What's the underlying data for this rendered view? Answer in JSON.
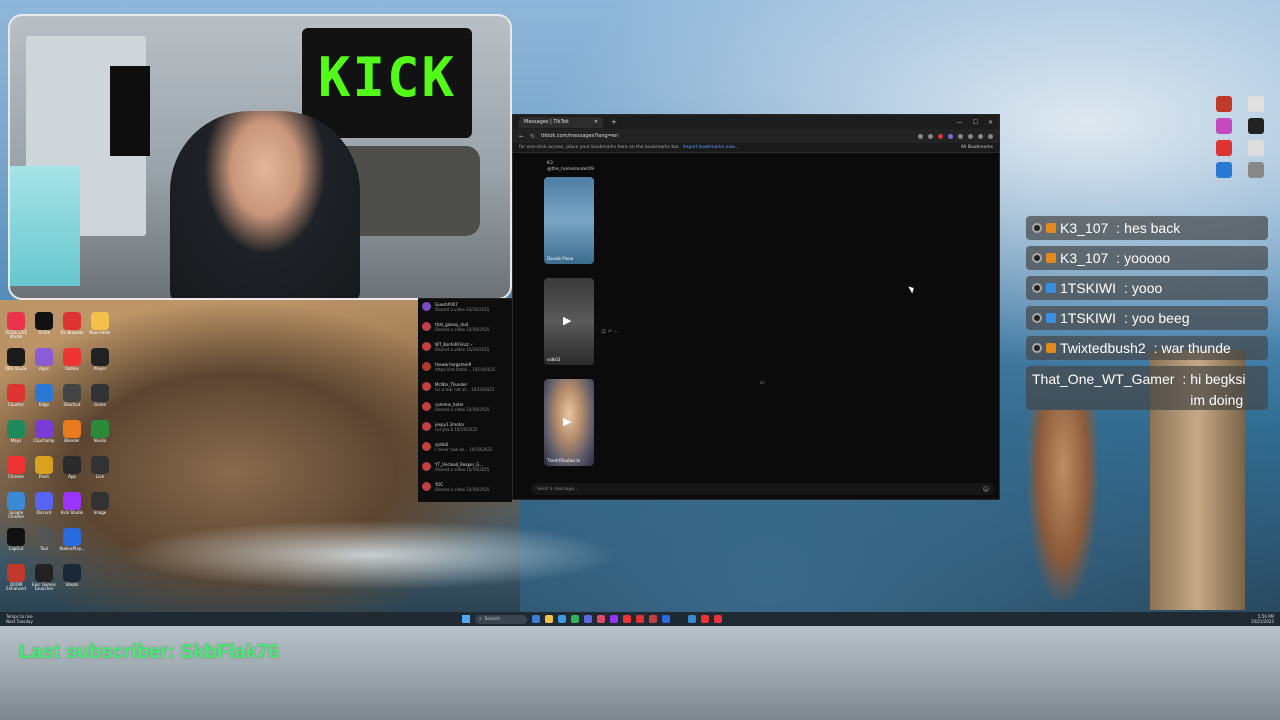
{
  "browser": {
    "tab_title": "Messages | TikTok",
    "new_tab": "+",
    "url": "tiktok.com/messages?lang=en",
    "bookmarks_hint": "for one-click access, place your bookmarks here on the bookmarks bar.",
    "bookmarks_link": "Import bookmarks now...",
    "all_bookmarks": "All Bookmarks",
    "chat_user": "K3",
    "chat_handle": "@the_homelander09",
    "videos": [
      {
        "caption": "Davide Pinea",
        "color": "v1"
      },
      {
        "caption": "vidk03",
        "color": "v2"
      },
      {
        "caption": "TheArtStudios.tv",
        "color": "v3"
      }
    ],
    "mini_text": "lol",
    "compose_placeholder": "Send a message..."
  },
  "dm_list": [
    {
      "name": "Guest#007",
      "sub": "Shared a video 10/19/2025",
      "color": "#7a4cc2"
    },
    {
      "name": "that_galaxy_dud",
      "sub": "Shared a video 10/19/2025",
      "color": "#c2404c"
    },
    {
      "name": "WT_KonfoRFlinzz ✓",
      "sub": "Shared a video 10/19/2025",
      "color": "#c24040"
    },
    {
      "name": "thewarriorgamer9",
      "sub": "https://int.tiktok... 10/19/2025",
      "color": "#b03a2e"
    },
    {
      "name": "McWar_Thunder",
      "sub": "Go a war not at... 10/19/2025",
      "color": "#c24040"
    },
    {
      "name": "commie_hater",
      "sub": "Shared a video 10/19/2025",
      "color": "#c24040"
    },
    {
      "name": "jeepy1.3motor",
      "sub": "Lol yea 8 10/19/2025",
      "color": "#c24040"
    },
    {
      "name": "zyhib0",
      "sub": "I never saw an... 10/19/2025",
      "color": "#c24040"
    },
    {
      "name": "YT_Unclead_Reaper_G...",
      "sub": "Shared a video 10/19/2025",
      "color": "#c24040"
    },
    {
      "name": "YOC",
      "sub": "Shared a video 10/19/2025",
      "color": "#c24040"
    }
  ],
  "chat": [
    {
      "user": "K3_107",
      "text": "hes back",
      "badge": "mod",
      "sub_color": "#e38a1f"
    },
    {
      "user": "K3_107",
      "text": "yooooo",
      "badge": "mod",
      "sub_color": "#e38a1f"
    },
    {
      "user": "1TSKIWI",
      "text": "yooo",
      "badge": "sub",
      "sub_color": "#3b8fe0"
    },
    {
      "user": "1TSKIWI",
      "text": "yoo beeg",
      "badge": "sub",
      "sub_color": "#3b8fe0"
    },
    {
      "user": "Twixtedbush2",
      "text": "war thunde",
      "badge": "sub",
      "sub_color": "#e38a1f"
    },
    {
      "user": "That_One_WT_Gamer",
      "text": "hi begksi im doing homework rn",
      "badge": "none",
      "sub_color": ""
    }
  ],
  "webcam": {
    "wall_sign": "KICK"
  },
  "taskbar": {
    "left_line1": "Temps to rise",
    "left_line2": "Next Tuesday",
    "search": "Search",
    "time": "5:56 PM",
    "date": "10/21/2025"
  },
  "overlay": {
    "last_subscriber": "Last subscriber: SkbFlak76"
  },
  "desktop_icons": [
    {
      "label": "TikTok LIVE Studio",
      "color": "#e8344d"
    },
    {
      "label": "TikTok",
      "color": "#111111"
    },
    {
      "label": "Tor Browser",
      "color": "#d33"
    },
    {
      "label": "New folder",
      "color": "#f2c14b"
    },
    {
      "label": "OBS Studio",
      "color": "#1a1a1a"
    },
    {
      "label": "Apps",
      "color": "#8a5cd6"
    },
    {
      "label": "Roblox",
      "color": "#e33"
    },
    {
      "label": "Player",
      "color": "#222"
    },
    {
      "label": "Counter",
      "color": "#d33"
    },
    {
      "label": "Edge",
      "color": "#2a7ad5"
    },
    {
      "label": "Shortcut",
      "color": "#444"
    },
    {
      "label": "Game",
      "color": "#333"
    },
    {
      "label": "Maps",
      "color": "#1d8a5a"
    },
    {
      "label": "Clipchamp",
      "color": "#7a3bd6"
    },
    {
      "label": "Blender",
      "color": "#ea7a1e"
    },
    {
      "label": "Nvidia",
      "color": "#2a8a3a"
    },
    {
      "label": "Chrome",
      "color": "#e33"
    },
    {
      "label": "Paint",
      "color": "#d8a21e"
    },
    {
      "label": "App",
      "color": "#2a2a2a"
    },
    {
      "label": "Live",
      "color": "#333"
    },
    {
      "label": "Google Chrome",
      "color": "#3a8ad6"
    },
    {
      "label": "Discord",
      "color": "#5865f2"
    },
    {
      "label": "Kick Studio",
      "color": "#9b33ff"
    },
    {
      "label": "Image",
      "color": "#333"
    },
    {
      "label": "CapCut",
      "color": "#111"
    },
    {
      "label": "Tool",
      "color": "#555"
    },
    {
      "label": "RobloxPlay...",
      "color": "#2a6ae0"
    },
    {
      "label": "",
      "color": "transparent"
    },
    {
      "label": "DOOM Enhanced",
      "color": "#c0392b"
    },
    {
      "label": "Epic Games Launcher",
      "color": "#222"
    },
    {
      "label": "Steam",
      "color": "#1b2838"
    },
    {
      "label": "",
      "color": "transparent"
    }
  ]
}
